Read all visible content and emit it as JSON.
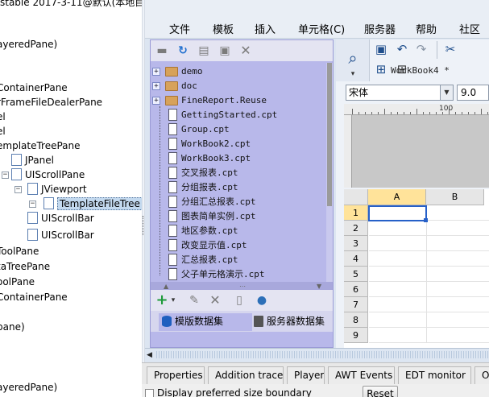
{
  "tree": {
    "root_label": "stable 2017-3-11@默认(本地目",
    "nodes": [
      {
        "label": "ayeredPane)"
      },
      {
        "label": "ContainerPane"
      },
      {
        "label": "rFrameFileDealerPane"
      },
      {
        "label": "el"
      },
      {
        "label": "el"
      },
      {
        "label": "emplateTreePane"
      },
      {
        "label": "JPanel"
      },
      {
        "label": "UIScrollPane"
      },
      {
        "label": "JViewport"
      },
      {
        "label": "TemplateFileTree"
      },
      {
        "label": "UIScrollBar"
      },
      {
        "label": "UIScrollBar"
      },
      {
        "label": "ToolPane"
      },
      {
        "label": "taTreePane"
      },
      {
        "label": "oolPane"
      },
      {
        "label": "ContainerPane"
      },
      {
        "label": "pane)"
      },
      {
        "label": "ayeredPane)"
      }
    ]
  },
  "app": {
    "menus": [
      "文件",
      "模板",
      "插入",
      "单元格(C)",
      "服务器",
      "帮助",
      "社区"
    ],
    "files": [
      {
        "name": "demo",
        "type": "folder"
      },
      {
        "name": "doc",
        "type": "folder"
      },
      {
        "name": "FineReport.Reuse",
        "type": "folder"
      },
      {
        "name": "GettingStarted.cpt",
        "type": "file"
      },
      {
        "name": "Group.cpt",
        "type": "file"
      },
      {
        "name": "WorkBook2.cpt",
        "type": "file"
      },
      {
        "name": "WorkBook3.cpt",
        "type": "file"
      },
      {
        "name": "交叉报表.cpt",
        "type": "file"
      },
      {
        "name": "分组报表.cpt",
        "type": "file"
      },
      {
        "name": "分组汇总报表.cpt",
        "type": "file"
      },
      {
        "name": "图表简单实例.cpt",
        "type": "file"
      },
      {
        "name": "地区参数.cpt",
        "type": "file"
      },
      {
        "name": "改变显示值.cpt",
        "type": "file"
      },
      {
        "name": "汇总报表.cpt",
        "type": "file"
      },
      {
        "name": "父子单元格演示.cpt",
        "type": "file"
      }
    ],
    "dataset_tabs": [
      "模版数据集",
      "服务器数据集"
    ],
    "workbook_tab": "WorkBook4 *",
    "font_name": "宋体",
    "font_size": "9.0",
    "ruler_label": "100",
    "columns": [
      "A",
      "B"
    ],
    "rows": [
      "1",
      "2",
      "3",
      "4",
      "5",
      "6",
      "7",
      "8",
      "9"
    ]
  },
  "bottom": {
    "tabs": [
      "Properties",
      "Addition trace",
      "Player",
      "AWT Events",
      "EDT monitor",
      "Op"
    ],
    "checkbox_label": "Display preferred size boundary",
    "reset_label": "Reset"
  },
  "colors": {
    "file_panel_bg": "#b8b8ea",
    "selection_border": "#2660c8",
    "selected_header": "#ffe39a",
    "tree_selection": "#c3d9ef"
  }
}
